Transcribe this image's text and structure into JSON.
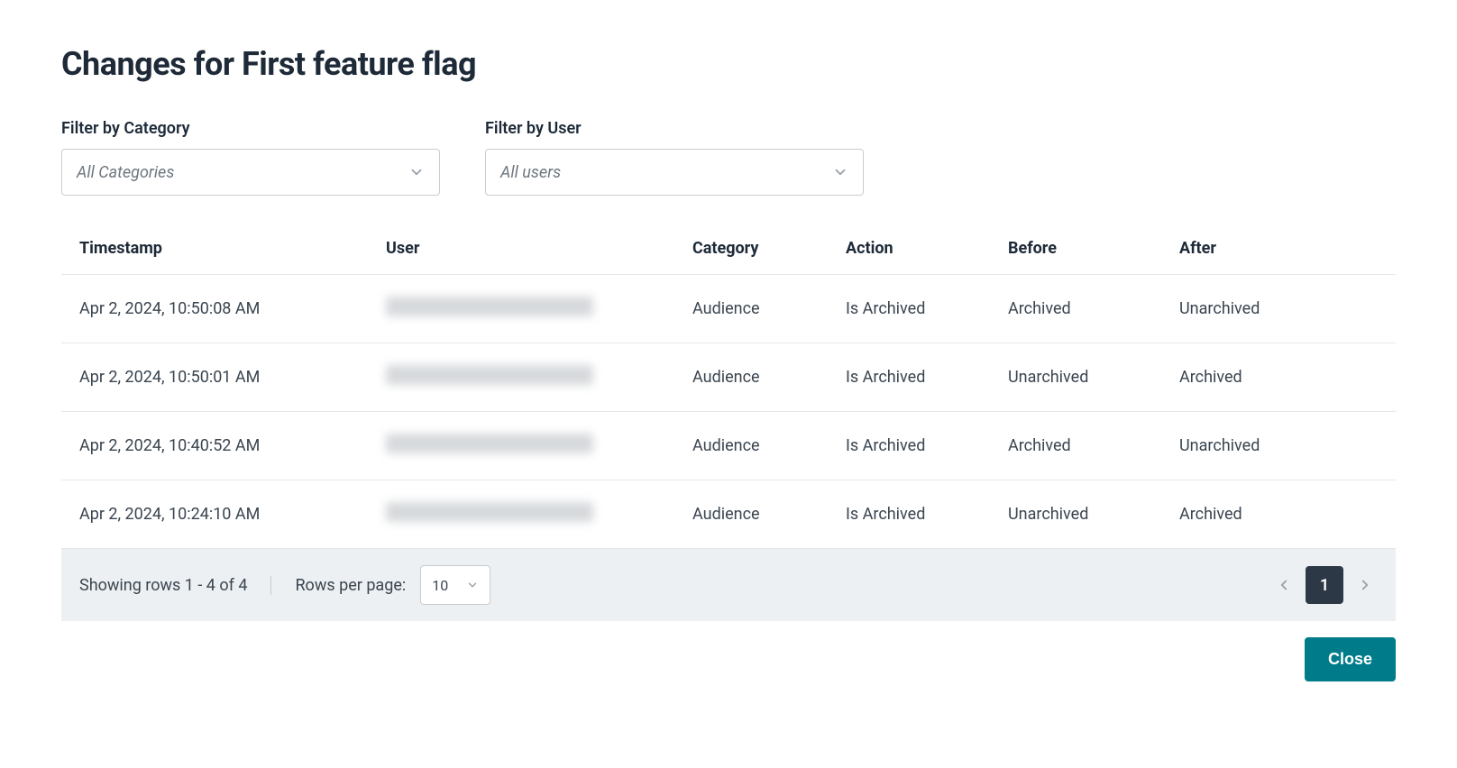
{
  "title": "Changes for First feature flag",
  "filters": {
    "category": {
      "label": "Filter by Category",
      "value": "All Categories"
    },
    "user": {
      "label": "Filter by User",
      "value": "All users"
    }
  },
  "table": {
    "columns": [
      "Timestamp",
      "User",
      "Category",
      "Action",
      "Before",
      "After"
    ],
    "rows": [
      {
        "timestamp": "Apr 2, 2024, 10:50:08 AM",
        "user": "[redacted]",
        "category": "Audience",
        "action": "Is Archived",
        "before": "Archived",
        "after": "Unarchived"
      },
      {
        "timestamp": "Apr 2, 2024, 10:50:01 AM",
        "user": "[redacted]",
        "category": "Audience",
        "action": "Is Archived",
        "before": "Unarchived",
        "after": "Archived"
      },
      {
        "timestamp": "Apr 2, 2024, 10:40:52 AM",
        "user": "[redacted]",
        "category": "Audience",
        "action": "Is Archived",
        "before": "Archived",
        "after": "Unarchived"
      },
      {
        "timestamp": "Apr 2, 2024, 10:24:10 AM",
        "user": "[redacted]",
        "category": "Audience",
        "action": "Is Archived",
        "before": "Unarchived",
        "after": "Archived"
      }
    ]
  },
  "pagination": {
    "showing_text": "Showing rows 1 - 4 of 4",
    "rows_per_page_label": "Rows per page:",
    "rows_per_page_value": "10",
    "current_page": "1"
  },
  "actions": {
    "close_label": "Close"
  }
}
